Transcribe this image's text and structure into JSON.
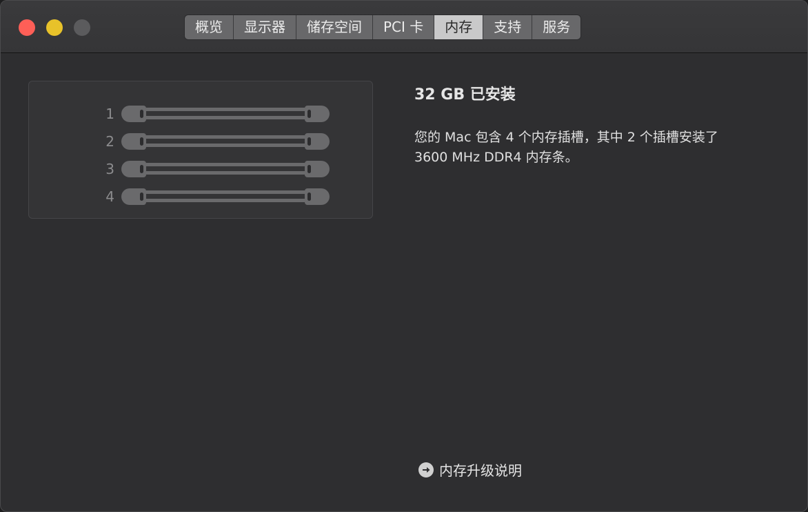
{
  "window": {
    "controls": [
      "close",
      "minimize",
      "zoom"
    ]
  },
  "tabs": [
    {
      "label": "概览",
      "selected": false
    },
    {
      "label": "显示器",
      "selected": false
    },
    {
      "label": "储存空间",
      "selected": false
    },
    {
      "label": "PCI 卡",
      "selected": false
    },
    {
      "label": "内存",
      "selected": true
    },
    {
      "label": "支持",
      "selected": false
    },
    {
      "label": "服务",
      "selected": false
    }
  ],
  "memory": {
    "slots": [
      {
        "label": "1"
      },
      {
        "label": "2"
      },
      {
        "label": "3"
      },
      {
        "label": "4"
      }
    ],
    "summary": "32 GB 已安装",
    "description_line1": "您的 Mac 包含 4 个内存插槽，其中 2 个插槽安装了",
    "description_line2": "3600 MHz DDR4 内存条。",
    "upgrade_link": "内存升级说明"
  },
  "icons": {
    "upgrade_link_icon": "arrow-right-circle-icon"
  },
  "colors": {
    "close": "#fe5f57",
    "minimize": "#e8c22a",
    "zoom": "#5b5b5d",
    "selected_tab": "#c9c9ca"
  }
}
